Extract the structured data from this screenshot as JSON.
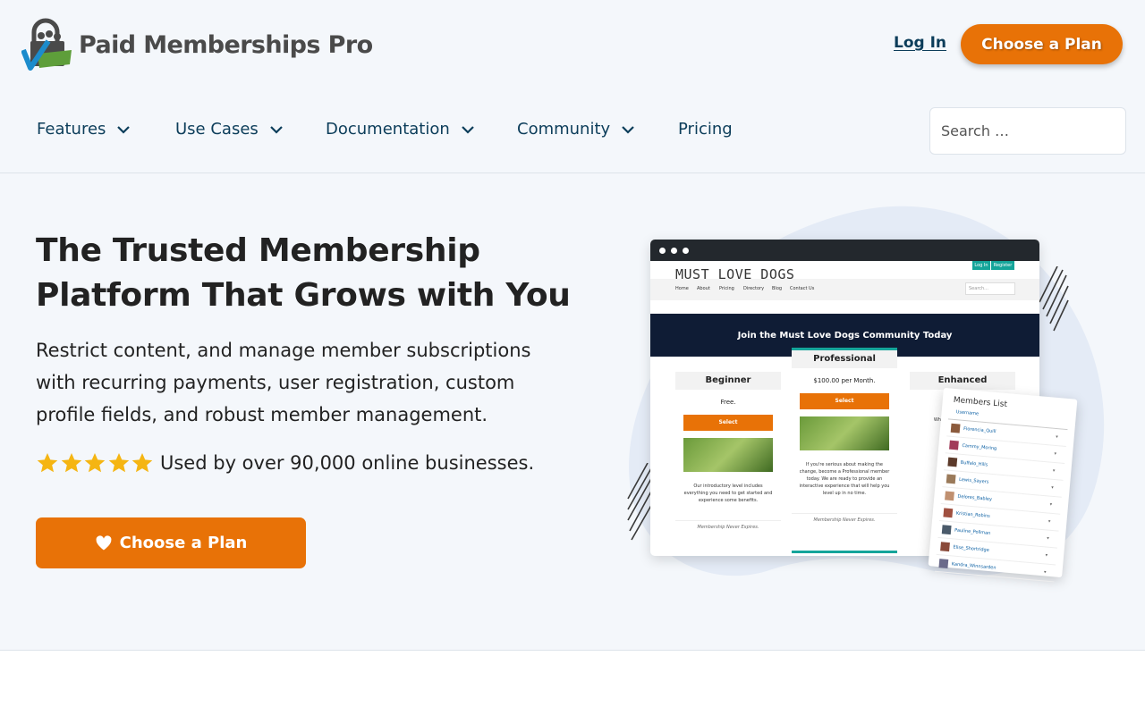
{
  "header": {
    "logo_text": "Paid Memberships Pro",
    "login_label": "Log In",
    "cta_label": "Choose a Plan"
  },
  "nav": {
    "items": [
      {
        "label": "Features",
        "has_dropdown": true
      },
      {
        "label": "Use Cases",
        "has_dropdown": true
      },
      {
        "label": "Documentation",
        "has_dropdown": true
      },
      {
        "label": "Community",
        "has_dropdown": true
      },
      {
        "label": "Pricing",
        "has_dropdown": false
      }
    ],
    "search_placeholder": "Search …"
  },
  "hero": {
    "title": "The Trusted Membership Platform That Grows with You",
    "subtitle": "Restrict content, and manage member subscriptions with recurring payments, user registration, custom profile fields, and robust member management.",
    "rating_stars": 5,
    "social_proof": "Used by over 90,000 online businesses.",
    "cta_label": "Choose a Plan"
  },
  "illustration": {
    "site_title": "MUST LOVE DOGS",
    "site_login": "Log In",
    "site_register": "Register",
    "site_nav": [
      "Home",
      "About",
      "Pricing",
      "Directory",
      "Blog",
      "Contact Us"
    ],
    "site_search": "Search...",
    "banner": "Join the Must Love Dogs Community Today",
    "tiers": [
      {
        "name": "Beginner",
        "price": "Free.",
        "button": "Select",
        "desc": "Our introductory level includes everything you need to get started and experience some benefits.",
        "footer": "Membership Never Expires."
      },
      {
        "name": "Professional",
        "price": "$100.00 per Month.",
        "button": "Select",
        "desc": "If you're serious about making the change, become a Professional member today. We are ready to provide an interactive experience that will help you level up in no time.",
        "footer": "Membership Never Expires."
      },
      {
        "name": "Enhanced",
        "price": "$25.",
        "button": "",
        "desc": "When yo our l incl knowle",
        "footer": ""
      }
    ],
    "members_title": "Members List",
    "members_header": "Username",
    "members": [
      "Florencia_Quill",
      "Cammy_Moring",
      "Buffalo_Hills",
      "Lewis_Sayers",
      "Delores_Babley",
      "Kristian_Robins",
      "Pauline_Pollman",
      "Elise_Shortridge",
      "Kandra_Winnsarden"
    ]
  },
  "colors": {
    "accent_orange": "#e87207",
    "navy_text": "#0c3d5a",
    "page_bg": "#f4f7fb",
    "star_gold": "#f5b512",
    "teal": "#15a59a"
  },
  "icons": {
    "logo": "padlock-checkmark-logo-icon",
    "dropdown": "chevron-down-icon",
    "star": "star-icon",
    "heart": "heart-icon"
  }
}
